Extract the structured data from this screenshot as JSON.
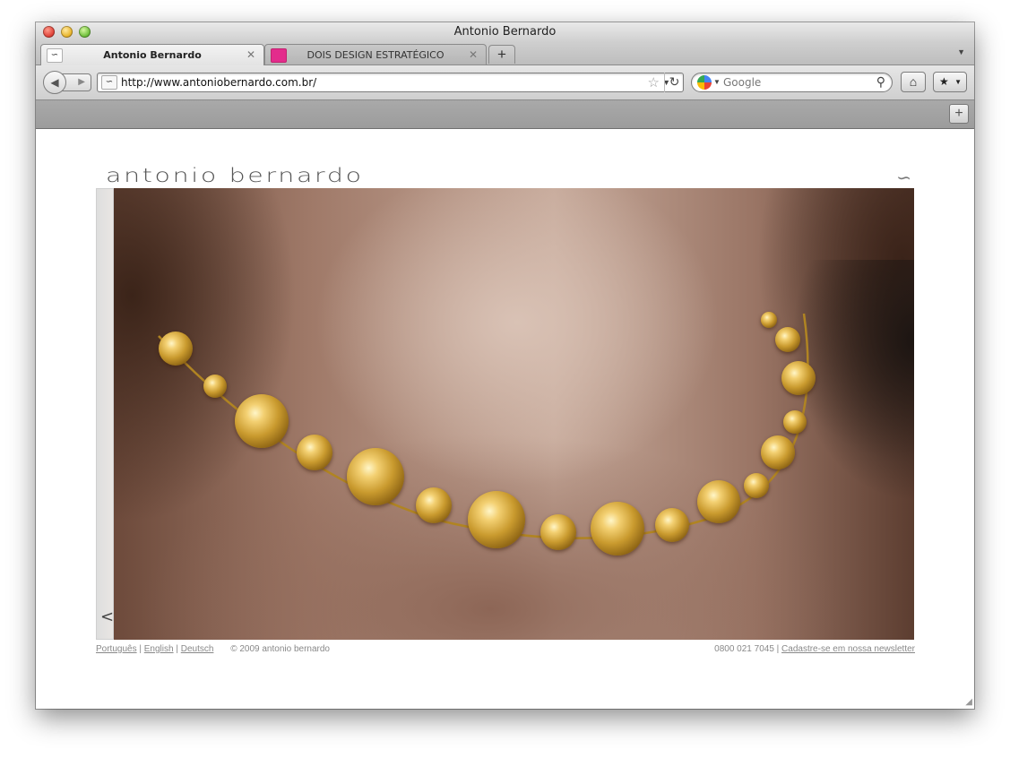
{
  "window": {
    "title": "Antonio Bernardo"
  },
  "tabs": [
    {
      "label": "Antonio Bernardo",
      "active": true,
      "favicon": "ab-logo-icon"
    },
    {
      "label": "DOIS DESIGN ESTRATÉGICO",
      "active": false,
      "favicon": "pink-square-icon",
      "favicon_color": "#e32c8c"
    }
  ],
  "toolbar": {
    "url": "http://www.antoniobernardo.com.br/",
    "search_placeholder": "Google",
    "new_tab_symbol": "+"
  },
  "page": {
    "logo_text": "antonio bernardo",
    "prev_symbol": "<",
    "hero_image": "gold-necklace-photo",
    "footer": {
      "languages": [
        "Português",
        "English",
        "Deutsch"
      ],
      "copyright": "© 2009 antonio bernardo",
      "phone": "0800 021 7045",
      "newsletter": "Cadastre-se em nossa newsletter"
    }
  }
}
